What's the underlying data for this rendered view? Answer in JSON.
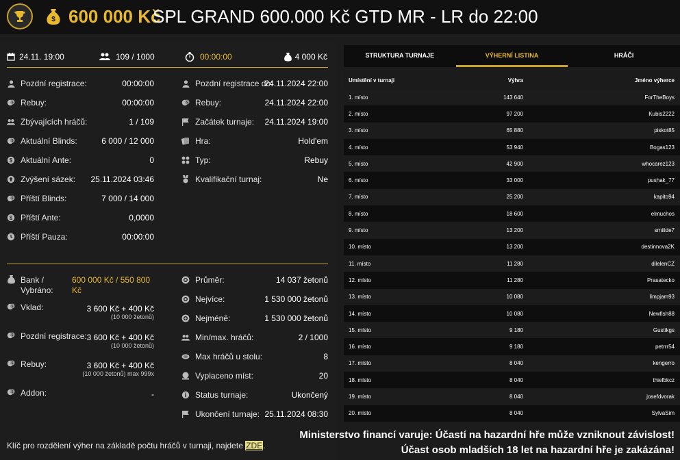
{
  "header": {
    "amount": "600 000 Kč",
    "title": "SPL GRAND 600.000 Kč GTD MR - LR do 22:00"
  },
  "topstats": {
    "date": "24.11. 19:00",
    "players": "109 / 1000",
    "timer": "00:00:00",
    "buyin": "4 000 Kč"
  },
  "left_col": [
    {
      "icon": "user-icon",
      "label": "Pozdní registrace:",
      "value": "00:00:00"
    },
    {
      "icon": "coin-icon",
      "label": "Rebuy:",
      "value": "00:00:00"
    },
    {
      "icon": "users-icon",
      "label": "Zbývajících hráčů:",
      "value": "1 / 109"
    },
    {
      "icon": "coin-icon",
      "label": "Aktuální Blinds:",
      "value": "6 000 / 12 000"
    },
    {
      "icon": "dollar-icon",
      "label": "Aktuální Ante:",
      "value": "0"
    },
    {
      "icon": "arrow-up-icon",
      "label": "Zvýšení sázek:",
      "value": "25.11.2024 03:46"
    },
    {
      "icon": "coin-icon",
      "label": "Příští Blinds:",
      "value": "7 000 / 14 000"
    },
    {
      "icon": "dollar-icon",
      "label": "Příští Ante:",
      "value": "0,0000"
    },
    {
      "icon": "clock-icon",
      "label": "Příští Pauza:",
      "value": "00:00:00"
    }
  ],
  "right_col": [
    {
      "icon": "user-icon",
      "label": "Pozdní registrace do:",
      "value": "24.11.2024 22:00"
    },
    {
      "icon": "coin-icon",
      "label": "Rebuy:",
      "value": "24.11.2024 22:00"
    },
    {
      "icon": "flag-icon",
      "label": "Začátek turnaje:",
      "value": "24.11.2024 19:00"
    },
    {
      "icon": "cards-icon",
      "label": "Hra:",
      "value": "Hold'em"
    },
    {
      "icon": "puzzle-icon",
      "label": "Typ:",
      "value": "Rebuy"
    },
    {
      "icon": "medal-icon",
      "label": "Kvalifikační turnaj:",
      "value": "Ne"
    }
  ],
  "bank": {
    "label1": "Bank /",
    "label2": "Vybráno:",
    "value1": "600 000 Kč / 550 800",
    "value2": "Kč"
  },
  "costs": [
    {
      "label": "Vklad:",
      "value": "3 600 Kč + 400 Kč",
      "sub": "(10 000 žetonů)"
    },
    {
      "label": "Pozdní registrace:",
      "value": "3 600 Kč + 400 Kč",
      "sub": "(10 000 žetonů)"
    },
    {
      "label": "Rebuy:",
      "value": "3 600 Kč + 400 Kč",
      "sub": "(10 000 žetonů) max 999x"
    },
    {
      "label": "Addon:",
      "value": "-",
      "sub": ""
    }
  ],
  "stats": [
    {
      "icon": "chip-icon",
      "label": "Průměr:",
      "value": "14 037 žetonů"
    },
    {
      "icon": "chip-icon",
      "label": "Nejvíce:",
      "value": "1 530 000 žetonů"
    },
    {
      "icon": "chip-icon",
      "label": "Nejméně:",
      "value": "1 530 000 žetonů"
    },
    {
      "icon": "users-icon",
      "label": "Min/max. hráčů:",
      "value": "2 / 1000"
    },
    {
      "icon": "table-icon",
      "label": "Max hráčů u stolu:",
      "value": "8"
    },
    {
      "icon": "payout-icon",
      "label": "Vyplaceno míst:",
      "value": "20"
    },
    {
      "icon": "info-icon",
      "label": "Status turnaje:",
      "value": "Ukončený"
    },
    {
      "icon": "flag-icon",
      "label": "Ukončení turnaje:",
      "value": "25.11.2024 08:30"
    }
  ],
  "footer_note": {
    "text": "Klíč pro rozdělení výher na základě počtu hráčů v turnaji, najdete ",
    "link": "ZDE",
    "tail": "."
  },
  "tabs": [
    {
      "label": "STRUKTURA TURNAJE",
      "active": false
    },
    {
      "label": "VÝHERNÍ LISTINA",
      "active": true
    },
    {
      "label": "HRÁČI",
      "active": false
    }
  ],
  "table": {
    "headers": [
      "Umístění v turnaji",
      "Výhra",
      "Jméno výherce"
    ],
    "rows": [
      [
        "1. místo",
        "143 640",
        "ForTheBoys"
      ],
      [
        "2. místo",
        "97 200",
        "Kubis2222"
      ],
      [
        "3. místo",
        "65 880",
        "piskot85"
      ],
      [
        "4. místo",
        "53 940",
        "Bogas123"
      ],
      [
        "5. místo",
        "42 900",
        "whocarez123"
      ],
      [
        "6. místo",
        "33 000",
        "pushak_77"
      ],
      [
        "7. místo",
        "25 200",
        "kapito94"
      ],
      [
        "8. místo",
        "18 600",
        "elmuchos"
      ],
      [
        "9. místo",
        "13 200",
        "smiiide7"
      ],
      [
        "10. místo",
        "13 200",
        "destinnova2K"
      ],
      [
        "11. místo",
        "11 280",
        "dilelenCZ"
      ],
      [
        "12. místo",
        "11 280",
        "Prasatecko"
      ],
      [
        "13. místo",
        "10 080",
        "limpjam93"
      ],
      [
        "14. místo",
        "10 080",
        "Newfish88"
      ],
      [
        "15. místo",
        "9 180",
        "Gustikgs"
      ],
      [
        "16. místo",
        "9 180",
        "petrrr54"
      ],
      [
        "17. místo",
        "8 040",
        "kengerro"
      ],
      [
        "18. místo",
        "8 040",
        "thiefbkcz"
      ],
      [
        "19. místo",
        "8 040",
        "josefdvorak"
      ],
      [
        "20. místo",
        "8 040",
        "SylvaSim"
      ]
    ]
  },
  "warning": {
    "line1": "Ministerstvo financí varuje: Účastí na hazardní hře může vzniknout závislost!",
    "line2": "Účast osob mladších 18 let na hazardní hře je zakázána!"
  }
}
